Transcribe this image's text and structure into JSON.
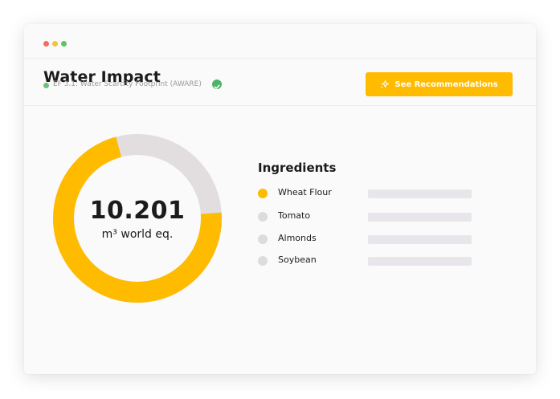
{
  "header": {
    "title": "Water Impact",
    "subtitle": "EF 3.1: Water Scarcity Footprint (AWARE)",
    "status_color": "#6cc17a",
    "verified_icon": "check-circle-icon"
  },
  "actions": {
    "recommendations_label": "See Recommendations",
    "recommendations_icon": "sparkle-icon",
    "accent_color": "#ffbb00"
  },
  "summary": {
    "value": "10.201",
    "unit": "m³ world eq.",
    "highlighted_share": 0.72,
    "highlight_color": "#ffbb00",
    "rest_color": "#e2dedf"
  },
  "ingredients": {
    "title": "Ingredients",
    "items": [
      {
        "label": "Wheat Flour",
        "active": true
      },
      {
        "label": "Tomato",
        "active": false
      },
      {
        "label": "Almonds",
        "active": false
      },
      {
        "label": "Soybean",
        "active": false
      }
    ]
  }
}
